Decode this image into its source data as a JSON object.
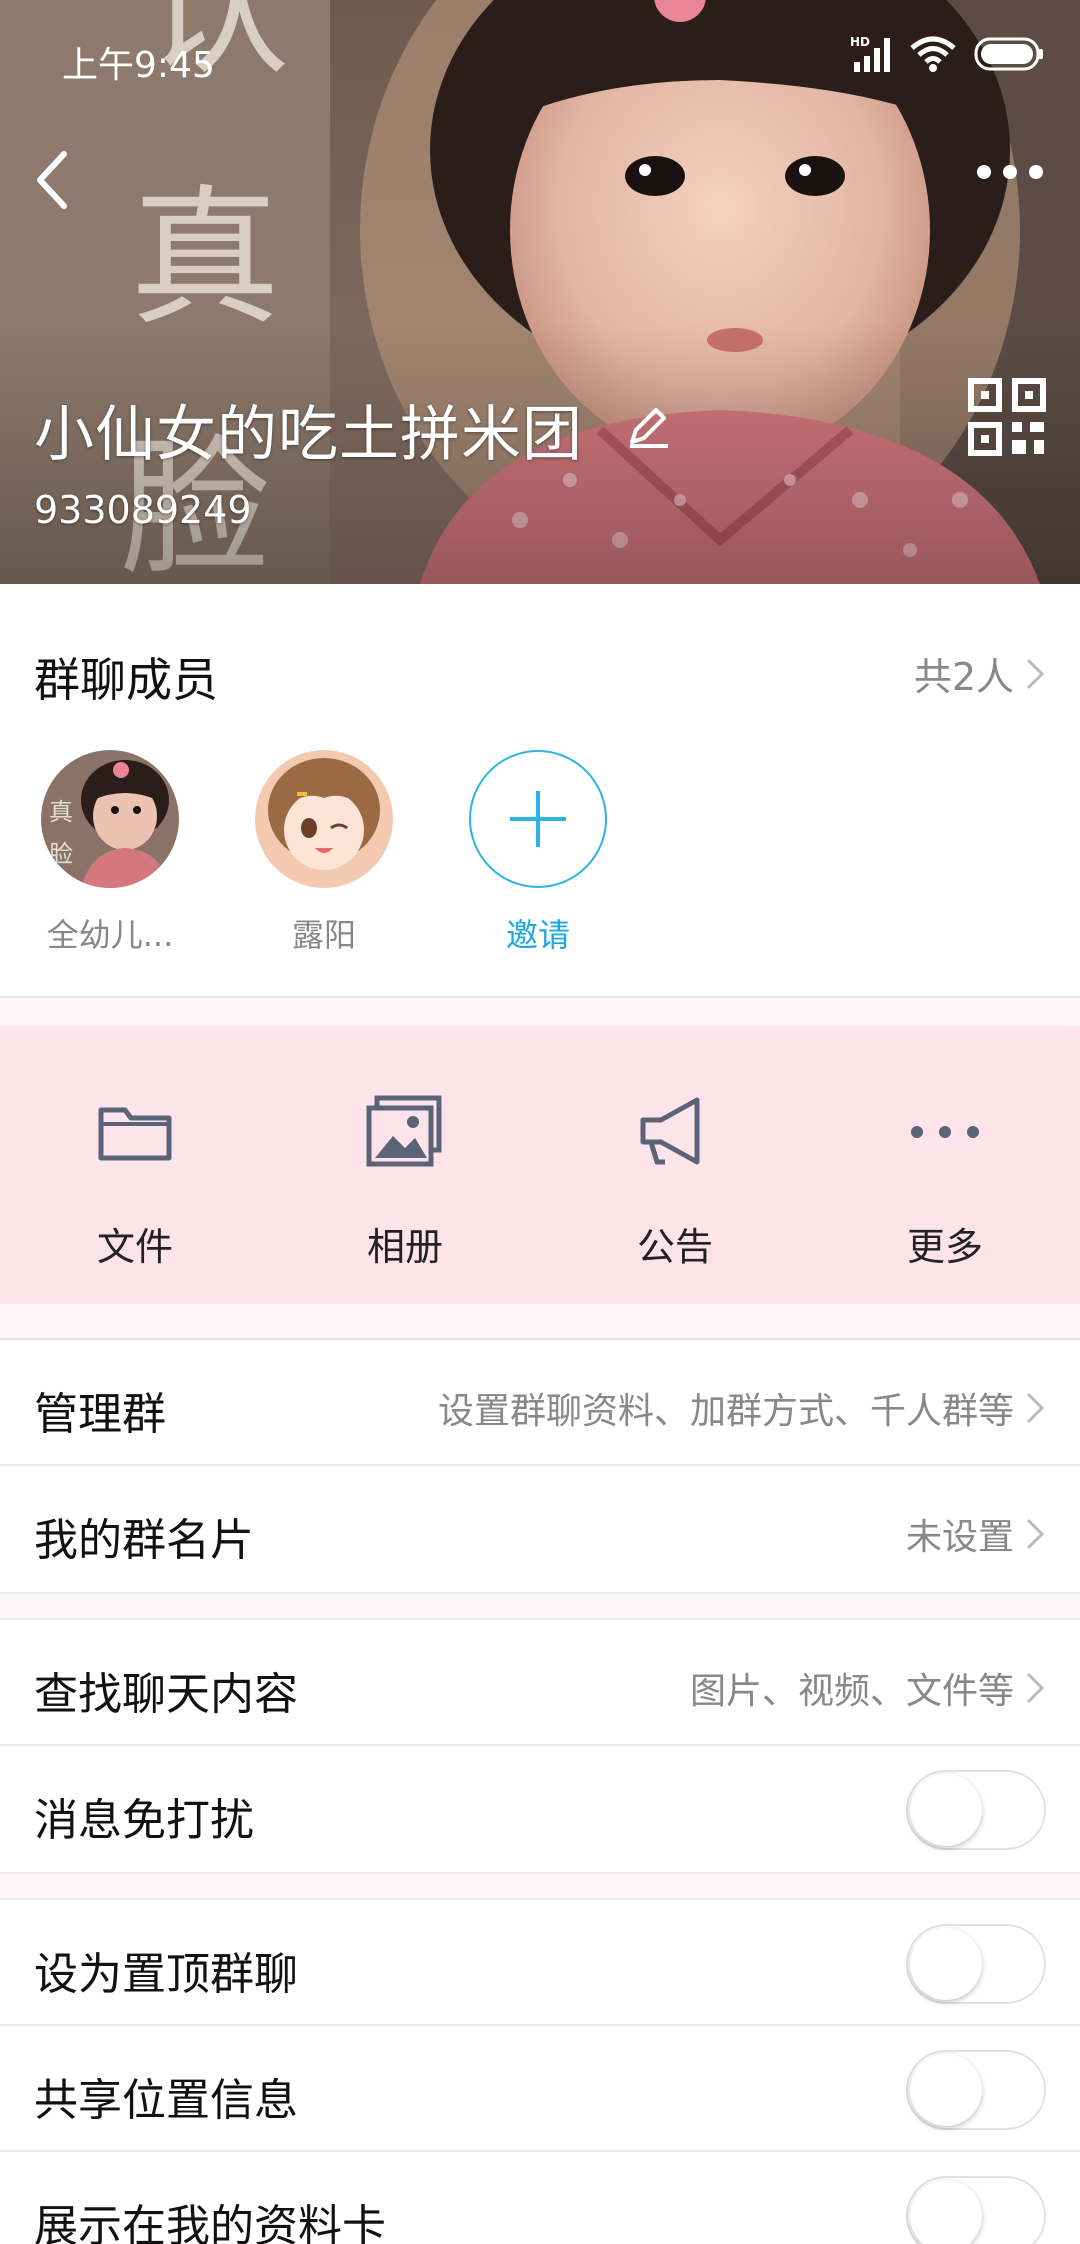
{
  "status_bar": {
    "time": "上午9:45",
    "network_badge": "HD"
  },
  "header": {
    "title": "小仙女的吃土拼米团",
    "group_number": "933089249",
    "photo_caption_glyphs": [
      "认",
      "真",
      "脸"
    ]
  },
  "members": {
    "title": "群聊成员",
    "count_label": "共2人",
    "list": [
      {
        "name": "全幼儿..."
      },
      {
        "name": "露阳"
      }
    ],
    "invite_label": "邀请"
  },
  "quick_actions": [
    {
      "label": "文件",
      "icon": "folder-icon"
    },
    {
      "label": "相册",
      "icon": "album-icon"
    },
    {
      "label": "公告",
      "icon": "megaphone-icon"
    },
    {
      "label": "更多",
      "icon": "more-dots-icon"
    }
  ],
  "settings": {
    "manage": {
      "label": "管理群",
      "value": "设置群聊资料、加群方式、千人群等"
    },
    "card": {
      "label": "我的群名片",
      "value": "未设置"
    },
    "search": {
      "label": "查找聊天内容",
      "value": "图片、视频、文件等"
    },
    "mute": {
      "label": "消息免打扰",
      "enabled": false
    },
    "pin": {
      "label": "设为置顶群聊",
      "enabled": false
    },
    "location": {
      "label": "共享位置信息",
      "enabled": false
    },
    "profile": {
      "label": "展示在我的资料卡",
      "enabled": false
    }
  },
  "colors": {
    "accent": "#1fa8de",
    "quick_bg": "#fde4ea",
    "icon_gray": "#5b6377"
  }
}
